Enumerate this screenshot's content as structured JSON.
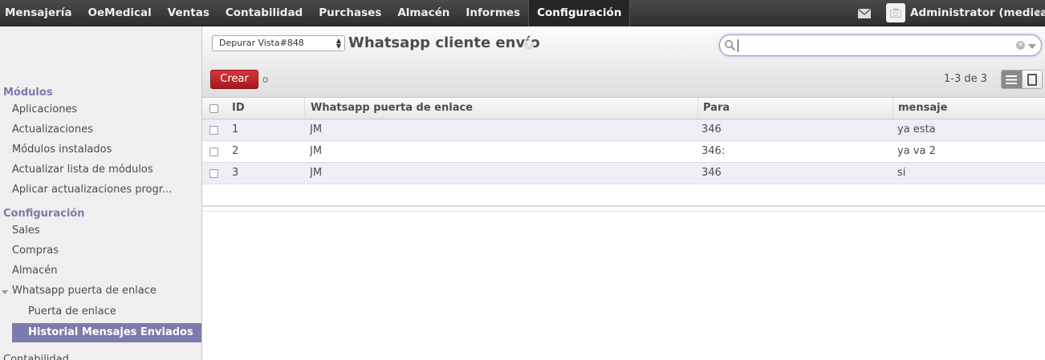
{
  "top_menu": {
    "items": [
      "Mensajería",
      "OeMedical",
      "Ventas",
      "Contabilidad",
      "Purchases",
      "Almacén",
      "Informes",
      "Configuración"
    ],
    "active": "Configuración",
    "user_name": "Administrator (medical)"
  },
  "sidebar": {
    "section_modules": "Módulos",
    "modules_items": [
      "Aplicaciones",
      "Actualizaciones",
      "Módulos instalados",
      "Actualizar lista de módulos",
      "Aplicar actualizaciones progr..."
    ],
    "section_config": "Configuración",
    "config_items": [
      "Sales",
      "Compras",
      "Almacén",
      "Whatsapp puerta de enlace"
    ],
    "whatsapp_subitems": [
      "Puerta de enlace",
      "Historial Mensajes Enviados"
    ],
    "next_section": "Contabilidad"
  },
  "control_panel": {
    "debug_select": "Depurar Vista#848",
    "title": "Whatsapp cliente envío",
    "help": "?",
    "search_value": "",
    "create_label": "Crear",
    "or_label": "o",
    "pager": "1-3 de 3"
  },
  "table": {
    "columns": [
      "ID",
      "Whatsapp puerta de enlace",
      "Para",
      "mensaje"
    ],
    "rows": [
      [
        "1",
        "JM",
        "346",
        "ya esta"
      ],
      [
        "2",
        "JM",
        "346:",
        "ya va 2"
      ],
      [
        "3",
        "JM",
        "346",
        "si"
      ]
    ]
  },
  "colors": {
    "topbar": "#3a3a3a",
    "accent": "#7c7bad",
    "create_button": "#c0262d",
    "odd_row": "#eeeef7"
  },
  "icons": [
    "mail-icon",
    "avatar",
    "search-icon",
    "clear-icon",
    "list-view-icon",
    "form-view-icon"
  ]
}
